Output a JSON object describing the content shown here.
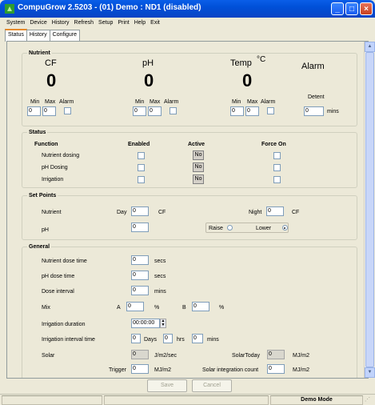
{
  "window": {
    "title": "CompuGrow 2.5203 - (01) Demo : ND1 (disabled)"
  },
  "menu": [
    "System",
    "Device",
    "History",
    "Refresh",
    "Setup",
    "Print",
    "Help",
    "Exit"
  ],
  "tabs": [
    "Status",
    "History",
    "Configure"
  ],
  "nutrient": {
    "title": "Nutrient",
    "cf": {
      "label": "CF",
      "value": "0",
      "min": "0",
      "max": "0"
    },
    "ph": {
      "label": "pH",
      "value": "0",
      "min": "0",
      "max": "0"
    },
    "temp": {
      "label": "Temp",
      "unit": "°C",
      "value": "0",
      "min": "0",
      "max": "0"
    },
    "alarm_label": "Alarm",
    "min_label": "Min",
    "max_label": "Max",
    "alarm_small": "Alarm",
    "detent_label": "Detent",
    "detent_value": "0",
    "detent_unit": "mins"
  },
  "status": {
    "title": "Status",
    "col_function": "Function",
    "col_enabled": "Enabled",
    "col_active": "Active",
    "col_force": "Force On",
    "rows": [
      {
        "name": "Nutrient dosing",
        "active": "No"
      },
      {
        "name": "pH Dosing",
        "active": "No"
      },
      {
        "name": "Irrigation",
        "active": "No"
      }
    ]
  },
  "setpoints": {
    "title": "Set Points",
    "nutrient_label": "Nutrient",
    "day_label": "Day",
    "day_value": "0",
    "day_unit": "CF",
    "night_label": "Night",
    "night_value": "0",
    "night_unit": "CF",
    "ph_label": "pH",
    "ph_value": "0",
    "raise_label": "Raise",
    "lower_label": "Lower",
    "selected": "Lower"
  },
  "general": {
    "title": "General",
    "dose_time_label": "Nutrient dose time",
    "dose_time_value": "0",
    "dose_time_unit": "secs",
    "ph_dose_label": "pH dose time",
    "ph_dose_value": "0",
    "ph_dose_unit": "secs",
    "interval_label": "Dose interval",
    "interval_value": "0",
    "interval_unit": "mins",
    "mix_label": "Mix",
    "a_label": "A",
    "a_value": "0",
    "pct": "%",
    "b_label": "B",
    "b_value": "0",
    "irr_dur_label": "Irrigation duration",
    "irr_dur_value": "00:00:00",
    "irr_int_label": "Irrigation interval time",
    "irr_days": "0",
    "days_label": "Days",
    "irr_hrs": "0",
    "hrs_label": "hrs",
    "irr_mins": "0",
    "mins_label": "mins",
    "solar_label": "Solar",
    "solar_value": "0",
    "solar_unit": "J/m2/sec",
    "solar_today_label": "SolarToday",
    "solar_today_value": "0",
    "solar_today_unit": "MJ/m2",
    "trigger_label": "Trigger",
    "trigger_value": "0",
    "trigger_unit": "MJ/m2",
    "solar_count_label": "Solar integration count",
    "solar_count_value": "0",
    "solar_count_unit": "MJ/m2"
  },
  "buttons": {
    "save": "Save",
    "cancel": "Cancel"
  },
  "statusbar": {
    "mode": "Demo Mode"
  },
  "colors": {
    "titlebar": "#0054e3",
    "tab_accent": "#e68b2c",
    "window_bg": "#ece9d8"
  }
}
